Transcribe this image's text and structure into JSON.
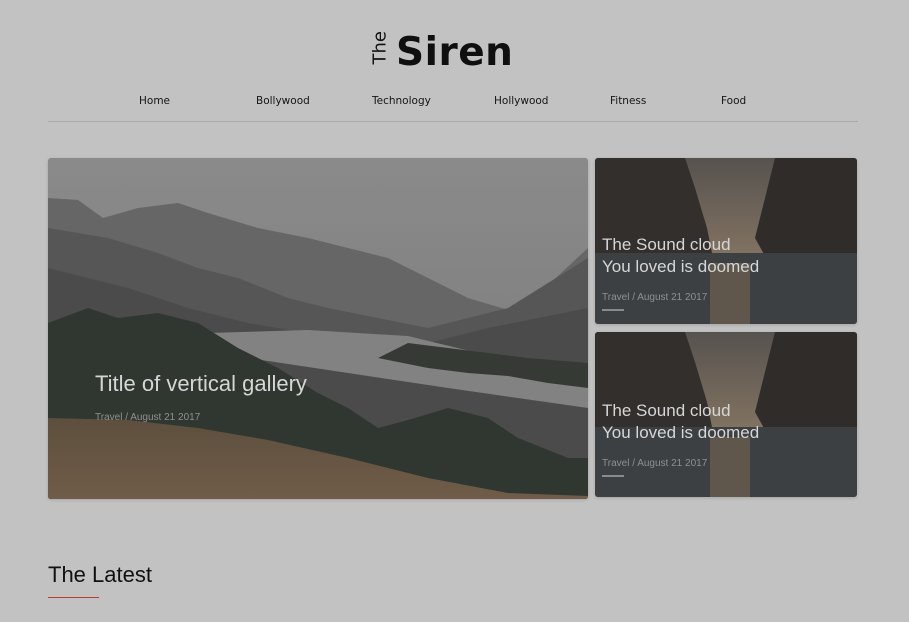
{
  "logo": {
    "the": "The",
    "siren": "Siren"
  },
  "nav": [
    "Home",
    "Bollywood",
    "Technology",
    "Hollywood",
    "Fitness",
    "Food"
  ],
  "featured": {
    "title": "Title of vertical gallery",
    "meta": "Travel / August 21 2017"
  },
  "side_cards": [
    {
      "title_line1": "The  Sound cloud",
      "title_line2": "You loved is doomed",
      "meta": "Travel / August 21 2017"
    },
    {
      "title_line1": "The  Sound cloud",
      "title_line2": "You loved is doomed",
      "meta": "Travel / August 21 2017"
    }
  ],
  "latest": {
    "title": "The Latest"
  },
  "colors": {
    "background": "#c2c2c2",
    "accent": "#c0392b"
  }
}
